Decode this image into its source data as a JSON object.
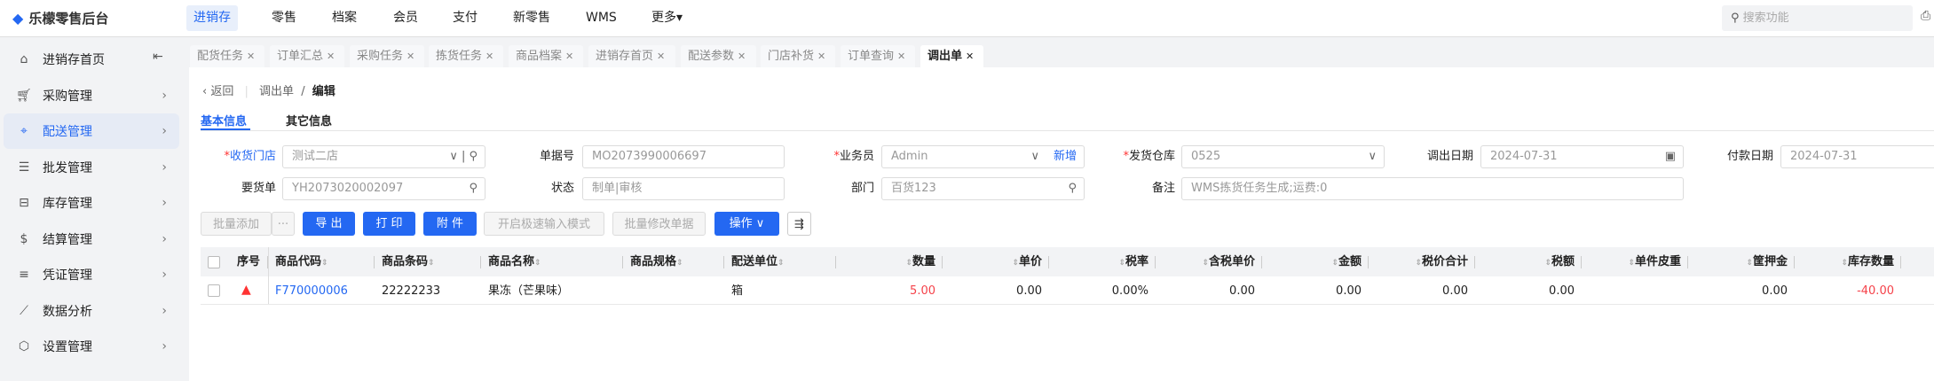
{
  "app": {
    "title": "乐檬零售后台",
    "search_placeholder": "搜索功能"
  },
  "topnav": [
    "进销存",
    "零售",
    "档案",
    "会员",
    "支付",
    "新零售",
    "WMS",
    "更多▾"
  ],
  "sidebar": [
    {
      "label": "进销存首页",
      "icon": "home-icon"
    },
    {
      "label": "采购管理",
      "icon": "cart-icon"
    },
    {
      "label": "配送管理",
      "icon": "map-icon",
      "active": true
    },
    {
      "label": "批发管理",
      "icon": "server-icon"
    },
    {
      "label": "库存管理",
      "icon": "inbox-icon"
    },
    {
      "label": "结算管理",
      "icon": "dollar-icon"
    },
    {
      "label": "凭证管理",
      "icon": "document-icon"
    },
    {
      "label": "数据分析",
      "icon": "chart-icon"
    },
    {
      "label": "设置管理",
      "icon": "settings-icon"
    }
  ],
  "tabs": [
    "配货任务",
    "订单汇总",
    "采购任务",
    "拣货任务",
    "商品档案",
    "进销存首页",
    "配送参数",
    "门店补货",
    "订单查询",
    "调出单"
  ],
  "breadcrumb": {
    "back": "返回",
    "parent": "调出单",
    "sep": "/",
    "current": "编辑"
  },
  "subtabs": [
    "基本信息",
    "其它信息"
  ],
  "form": {
    "store": {
      "label": "收货门店",
      "value": "测试二店"
    },
    "doc_no": {
      "label": "单据号",
      "value": "MO2073990006697"
    },
    "salesman": {
      "label": "业务员",
      "value": "Admin",
      "add": "新增"
    },
    "warehouse": {
      "label": "发货仓库",
      "value": "0525"
    },
    "out_date": {
      "label": "调出日期",
      "value": "2024-07-31"
    },
    "pay_date": {
      "label": "付款日期",
      "value": "2024-07-31"
    },
    "req_order": {
      "label": "要货单",
      "value": "YH2073020002097"
    },
    "status": {
      "label": "状态",
      "value": "制单|审核"
    },
    "dept": {
      "label": "部门",
      "value": "百货123"
    },
    "remark": {
      "label": "备注",
      "value": "WMS拣货任务生成;运费:0"
    }
  },
  "toolbar": {
    "batch_add": "批量添加",
    "more": "···",
    "export": "导 出",
    "print": "打 印",
    "attach": "附 件",
    "fast_input": "开启极速输入模式",
    "batch_edit": "批量修改单据",
    "ops": "操作 ∨"
  },
  "colors": {
    "accent": "#2468f2",
    "negative": "#f5424a"
  },
  "table": {
    "columns": [
      "序号",
      "商品代码",
      "商品条码",
      "商品名称",
      "商品规格",
      "配送单位",
      "数量",
      "单价",
      "税率",
      "含税单价",
      "金额",
      "税价合计",
      "税额",
      "单件皮重",
      "筐押金",
      "库存数量"
    ],
    "rows": [
      [
        "",
        "F770000006",
        "22222233",
        "果冻（芒果味）",
        "",
        "箱",
        "5.00",
        "0.00",
        "0.00%",
        "0.00",
        "0.00",
        "0.00",
        "0.00",
        "",
        "0.00",
        "-40.00"
      ]
    ]
  }
}
